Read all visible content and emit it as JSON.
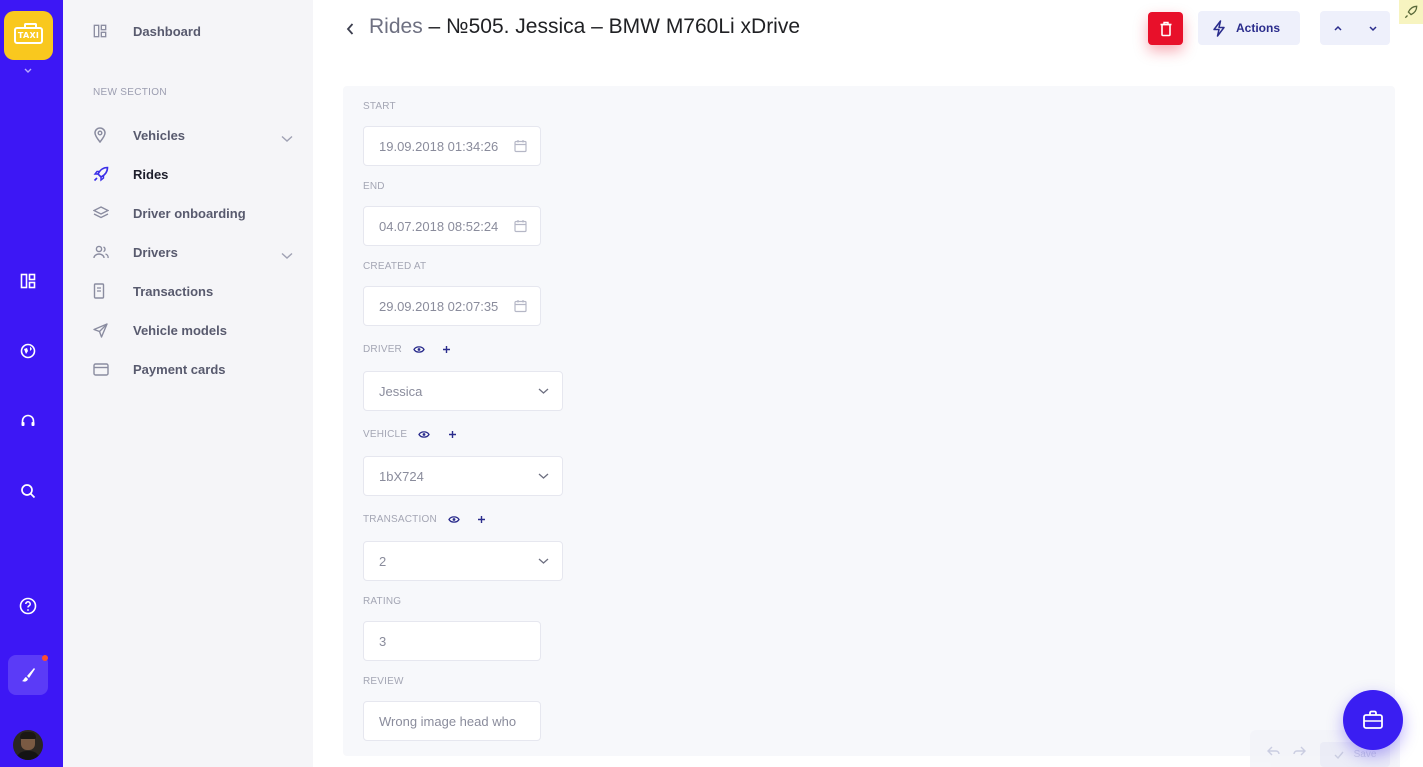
{
  "app": {
    "logo_text": "TAXI"
  },
  "rail": {
    "icons": [
      "dashboard-icon",
      "globe-icon",
      "support-icon",
      "search-icon",
      "help-icon",
      "brush-icon"
    ]
  },
  "sidebar": {
    "items_top": [
      {
        "label": "Dashboard",
        "icon": "dashboard-icon"
      }
    ],
    "section_title": "NEW SECTION",
    "items": [
      {
        "label": "Vehicles",
        "icon": "pin-icon",
        "expandable": true
      },
      {
        "label": "Rides",
        "icon": "rocket-icon",
        "active": true
      },
      {
        "label": "Driver onboarding",
        "icon": "layers-icon"
      },
      {
        "label": "Drivers",
        "icon": "users-icon",
        "expandable": true
      },
      {
        "label": "Transactions",
        "icon": "receipt-icon"
      },
      {
        "label": "Vehicle models",
        "icon": "send-icon"
      },
      {
        "label": "Payment cards",
        "icon": "card-icon"
      }
    ]
  },
  "header": {
    "breadcrumb": "Rides",
    "title_rest": " – №505. Jessica – BMW M760Li xDrive",
    "actions_label": "Actions"
  },
  "form": {
    "start": {
      "label": "START",
      "value": "19.09.2018 01:34:26"
    },
    "end": {
      "label": "END",
      "value": "04.07.2018 08:52:24"
    },
    "created_at": {
      "label": "CREATED AT",
      "value": "29.09.2018 02:07:35"
    },
    "driver": {
      "label": "DRIVER",
      "value": "Jessica"
    },
    "vehicle": {
      "label": "VEHICLE",
      "value": "1bX724"
    },
    "transaction": {
      "label": "TRANSACTION",
      "value": "2"
    },
    "rating": {
      "label": "RATING",
      "value": "3"
    },
    "review": {
      "label": "REVIEW",
      "value": "Wrong image head who"
    }
  },
  "savebar": {
    "save_label": "Save"
  },
  "colors": {
    "rail": "#3d17f5",
    "logo": "#f9c81e",
    "delete": "#e8102a",
    "fab": "#3a1ef2"
  }
}
